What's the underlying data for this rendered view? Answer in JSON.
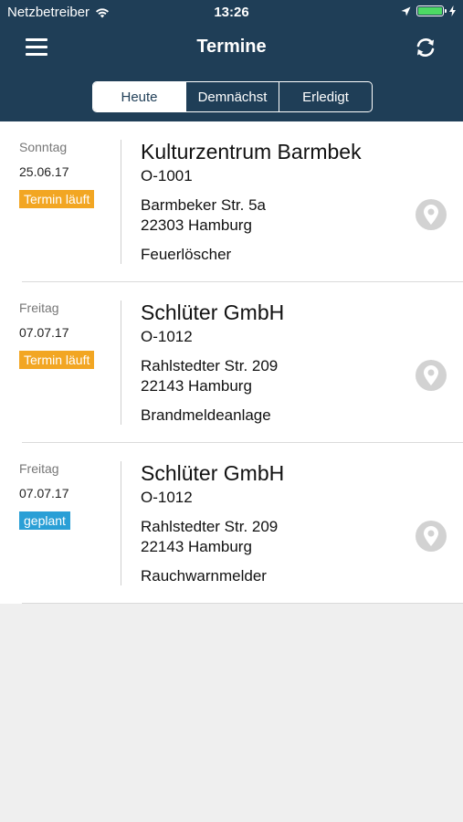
{
  "status": {
    "carrier": "Netzbetreiber",
    "time": "13:26"
  },
  "nav": {
    "title": "Termine",
    "tabs": [
      "Heute",
      "Demnächst",
      "Erledigt"
    ],
    "active_tab": 0
  },
  "colors": {
    "navbar": "#1f3e57",
    "badge_running": "#f2a623",
    "badge_planned": "#2a9fd6",
    "battery": "#4cd964"
  },
  "appointments": [
    {
      "day": "Sonntag",
      "date": "25.06.17",
      "status": "Termin läuft",
      "status_kind": "running",
      "name": "Kulturzentrum Barmbek",
      "code": "O-1001",
      "street": "Barmbeker Str. 5a",
      "city": "22303 Hamburg",
      "type": "Feuerlöscher"
    },
    {
      "day": "Freitag",
      "date": "07.07.17",
      "status": "Termin läuft",
      "status_kind": "running",
      "name": "Schlüter GmbH",
      "code": "O-1012",
      "street": "Rahlstedter Str. 209",
      "city": "22143 Hamburg",
      "type": "Brandmeldeanlage"
    },
    {
      "day": "Freitag",
      "date": "07.07.17",
      "status": "geplant",
      "status_kind": "planned",
      "name": "Schlüter GmbH",
      "code": "O-1012",
      "street": "Rahlstedter Str. 209",
      "city": "22143 Hamburg",
      "type": "Rauchwarnmelder"
    }
  ]
}
